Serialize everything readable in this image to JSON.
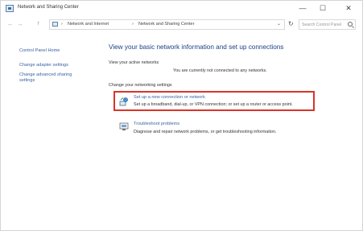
{
  "window": {
    "title": "Network and Sharing Center",
    "minimize_glyph": "—",
    "maximize_glyph": "☐",
    "close_glyph": "✕"
  },
  "address": {
    "back_glyph": "←",
    "forward_glyph": "→",
    "up_glyph": "↑",
    "separator": "›",
    "breadcrumbs": [
      "Network and Internet",
      "Network and Sharing Center"
    ],
    "dropdown_glyph": "⌄",
    "refresh_glyph": "↻",
    "search_placeholder": "Search Control Panel"
  },
  "sidebar": {
    "home_label": "Control Panel Home",
    "adapter_label": "Change adapter settings",
    "advanced_label_line1": "Change advanced sharing",
    "advanced_label_line2": "settings"
  },
  "main": {
    "title": "View your basic network information and set up connections",
    "active_networks_label": "View your active networks",
    "status_text": "You are currently not connected to any networks.",
    "change_settings_label": "Change your networking settings",
    "tasks": [
      {
        "link": "Set up a new connection or network",
        "description": "Set up a broadband, dial-up, or VPN connection; or set up a router or access point.",
        "icon": "network-setup-icon"
      },
      {
        "link": "Troubleshoot problems",
        "description": "Diagnose and repair network problems, or get troubleshooting information.",
        "icon": "troubleshoot-icon"
      }
    ],
    "highlight_color": "#d9342b",
    "link_color": "#3b62a3",
    "title_color": "#1e3f86"
  }
}
